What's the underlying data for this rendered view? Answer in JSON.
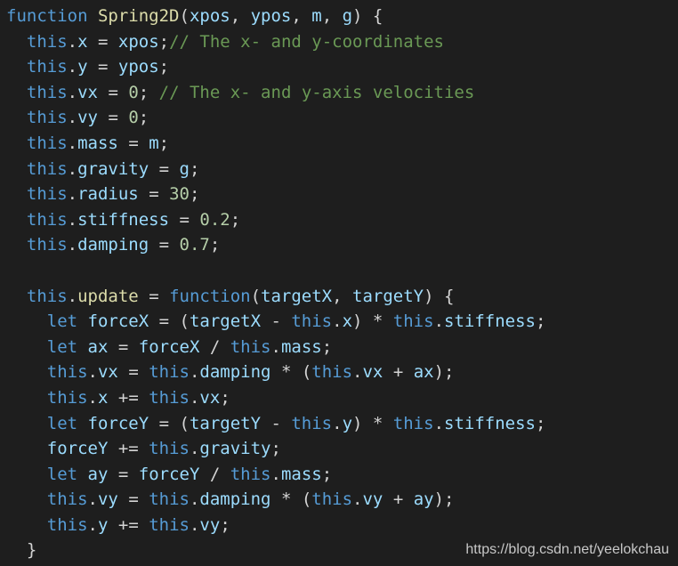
{
  "editor": {
    "language": "javascript",
    "theme_colors": {
      "background": "#1e1e1e",
      "keyword": "#569cd6",
      "function_name": "#dcdcaa",
      "variable": "#9cdcfe",
      "comment": "#6a9955",
      "number": "#b5cea8",
      "punctuation": "#d4d4d4"
    },
    "lines": [
      [
        [
          "keyword",
          "function"
        ],
        [
          "punct",
          " "
        ],
        [
          "fn",
          "Spring2D"
        ],
        [
          "punct",
          "("
        ],
        [
          "var",
          "xpos"
        ],
        [
          "punct",
          ", "
        ],
        [
          "var",
          "ypos"
        ],
        [
          "punct",
          ", "
        ],
        [
          "var",
          "m"
        ],
        [
          "punct",
          ", "
        ],
        [
          "var",
          "g"
        ],
        [
          "punct",
          ") {"
        ]
      ],
      [
        [
          "punct",
          "  "
        ],
        [
          "keyword",
          "this"
        ],
        [
          "punct",
          "."
        ],
        [
          "var",
          "x"
        ],
        [
          "punct",
          " = "
        ],
        [
          "var",
          "xpos"
        ],
        [
          "punct",
          ";"
        ],
        [
          "comment",
          "// The x- and y-coordinates"
        ]
      ],
      [
        [
          "punct",
          "  "
        ],
        [
          "keyword",
          "this"
        ],
        [
          "punct",
          "."
        ],
        [
          "var",
          "y"
        ],
        [
          "punct",
          " = "
        ],
        [
          "var",
          "ypos"
        ],
        [
          "punct",
          ";"
        ]
      ],
      [
        [
          "punct",
          "  "
        ],
        [
          "keyword",
          "this"
        ],
        [
          "punct",
          "."
        ],
        [
          "var",
          "vx"
        ],
        [
          "punct",
          " = "
        ],
        [
          "num",
          "0"
        ],
        [
          "punct",
          "; "
        ],
        [
          "comment",
          "// The x- and y-axis velocities"
        ]
      ],
      [
        [
          "punct",
          "  "
        ],
        [
          "keyword",
          "this"
        ],
        [
          "punct",
          "."
        ],
        [
          "var",
          "vy"
        ],
        [
          "punct",
          " = "
        ],
        [
          "num",
          "0"
        ],
        [
          "punct",
          ";"
        ]
      ],
      [
        [
          "punct",
          "  "
        ],
        [
          "keyword",
          "this"
        ],
        [
          "punct",
          "."
        ],
        [
          "var",
          "mass"
        ],
        [
          "punct",
          " = "
        ],
        [
          "var",
          "m"
        ],
        [
          "punct",
          ";"
        ]
      ],
      [
        [
          "punct",
          "  "
        ],
        [
          "keyword",
          "this"
        ],
        [
          "punct",
          "."
        ],
        [
          "var",
          "gravity"
        ],
        [
          "punct",
          " = "
        ],
        [
          "var",
          "g"
        ],
        [
          "punct",
          ";"
        ]
      ],
      [
        [
          "punct",
          "  "
        ],
        [
          "keyword",
          "this"
        ],
        [
          "punct",
          "."
        ],
        [
          "var",
          "radius"
        ],
        [
          "punct",
          " = "
        ],
        [
          "num",
          "30"
        ],
        [
          "punct",
          ";"
        ]
      ],
      [
        [
          "punct",
          "  "
        ],
        [
          "keyword",
          "this"
        ],
        [
          "punct",
          "."
        ],
        [
          "var",
          "stiffness"
        ],
        [
          "punct",
          " = "
        ],
        [
          "num",
          "0.2"
        ],
        [
          "punct",
          ";"
        ]
      ],
      [
        [
          "punct",
          "  "
        ],
        [
          "keyword",
          "this"
        ],
        [
          "punct",
          "."
        ],
        [
          "var",
          "damping"
        ],
        [
          "punct",
          " = "
        ],
        [
          "num",
          "0.7"
        ],
        [
          "punct",
          ";"
        ]
      ],
      [],
      [
        [
          "punct",
          "  "
        ],
        [
          "keyword",
          "this"
        ],
        [
          "punct",
          "."
        ],
        [
          "fn",
          "update"
        ],
        [
          "punct",
          " = "
        ],
        [
          "keyword",
          "function"
        ],
        [
          "punct",
          "("
        ],
        [
          "var",
          "targetX"
        ],
        [
          "punct",
          ", "
        ],
        [
          "var",
          "targetY"
        ],
        [
          "punct",
          ") {"
        ]
      ],
      [
        [
          "punct",
          "    "
        ],
        [
          "keyword",
          "let"
        ],
        [
          "punct",
          " "
        ],
        [
          "var",
          "forceX"
        ],
        [
          "punct",
          " = ("
        ],
        [
          "var",
          "targetX"
        ],
        [
          "punct",
          " - "
        ],
        [
          "keyword",
          "this"
        ],
        [
          "punct",
          "."
        ],
        [
          "var",
          "x"
        ],
        [
          "punct",
          ") * "
        ],
        [
          "keyword",
          "this"
        ],
        [
          "punct",
          "."
        ],
        [
          "var",
          "stiffness"
        ],
        [
          "punct",
          ";"
        ]
      ],
      [
        [
          "punct",
          "    "
        ],
        [
          "keyword",
          "let"
        ],
        [
          "punct",
          " "
        ],
        [
          "var",
          "ax"
        ],
        [
          "punct",
          " = "
        ],
        [
          "var",
          "forceX"
        ],
        [
          "punct",
          " / "
        ],
        [
          "keyword",
          "this"
        ],
        [
          "punct",
          "."
        ],
        [
          "var",
          "mass"
        ],
        [
          "punct",
          ";"
        ]
      ],
      [
        [
          "punct",
          "    "
        ],
        [
          "keyword",
          "this"
        ],
        [
          "punct",
          "."
        ],
        [
          "var",
          "vx"
        ],
        [
          "punct",
          " = "
        ],
        [
          "keyword",
          "this"
        ],
        [
          "punct",
          "."
        ],
        [
          "var",
          "damping"
        ],
        [
          "punct",
          " * ("
        ],
        [
          "keyword",
          "this"
        ],
        [
          "punct",
          "."
        ],
        [
          "var",
          "vx"
        ],
        [
          "punct",
          " + "
        ],
        [
          "var",
          "ax"
        ],
        [
          "punct",
          ");"
        ]
      ],
      [
        [
          "punct",
          "    "
        ],
        [
          "keyword",
          "this"
        ],
        [
          "punct",
          "."
        ],
        [
          "var",
          "x"
        ],
        [
          "punct",
          " += "
        ],
        [
          "keyword",
          "this"
        ],
        [
          "punct",
          "."
        ],
        [
          "var",
          "vx"
        ],
        [
          "punct",
          ";"
        ]
      ],
      [
        [
          "punct",
          "    "
        ],
        [
          "keyword",
          "let"
        ],
        [
          "punct",
          " "
        ],
        [
          "var",
          "forceY"
        ],
        [
          "punct",
          " = ("
        ],
        [
          "var",
          "targetY"
        ],
        [
          "punct",
          " - "
        ],
        [
          "keyword",
          "this"
        ],
        [
          "punct",
          "."
        ],
        [
          "var",
          "y"
        ],
        [
          "punct",
          ") * "
        ],
        [
          "keyword",
          "this"
        ],
        [
          "punct",
          "."
        ],
        [
          "var",
          "stiffness"
        ],
        [
          "punct",
          ";"
        ]
      ],
      [
        [
          "punct",
          "    "
        ],
        [
          "var",
          "forceY"
        ],
        [
          "punct",
          " += "
        ],
        [
          "keyword",
          "this"
        ],
        [
          "punct",
          "."
        ],
        [
          "var",
          "gravity"
        ],
        [
          "punct",
          ";"
        ]
      ],
      [
        [
          "punct",
          "    "
        ],
        [
          "keyword",
          "let"
        ],
        [
          "punct",
          " "
        ],
        [
          "var",
          "ay"
        ],
        [
          "punct",
          " = "
        ],
        [
          "var",
          "forceY"
        ],
        [
          "punct",
          " / "
        ],
        [
          "keyword",
          "this"
        ],
        [
          "punct",
          "."
        ],
        [
          "var",
          "mass"
        ],
        [
          "punct",
          ";"
        ]
      ],
      [
        [
          "punct",
          "    "
        ],
        [
          "keyword",
          "this"
        ],
        [
          "punct",
          "."
        ],
        [
          "var",
          "vy"
        ],
        [
          "punct",
          " = "
        ],
        [
          "keyword",
          "this"
        ],
        [
          "punct",
          "."
        ],
        [
          "var",
          "damping"
        ],
        [
          "punct",
          " * ("
        ],
        [
          "keyword",
          "this"
        ],
        [
          "punct",
          "."
        ],
        [
          "var",
          "vy"
        ],
        [
          "punct",
          " + "
        ],
        [
          "var",
          "ay"
        ],
        [
          "punct",
          ");"
        ]
      ],
      [
        [
          "punct",
          "    "
        ],
        [
          "keyword",
          "this"
        ],
        [
          "punct",
          "."
        ],
        [
          "var",
          "y"
        ],
        [
          "punct",
          " += "
        ],
        [
          "keyword",
          "this"
        ],
        [
          "punct",
          "."
        ],
        [
          "var",
          "vy"
        ],
        [
          "punct",
          ";"
        ]
      ],
      [
        [
          "punct",
          "  }"
        ]
      ]
    ]
  },
  "watermark": {
    "text": "https://blog.csdn.net/yeelokchau"
  }
}
